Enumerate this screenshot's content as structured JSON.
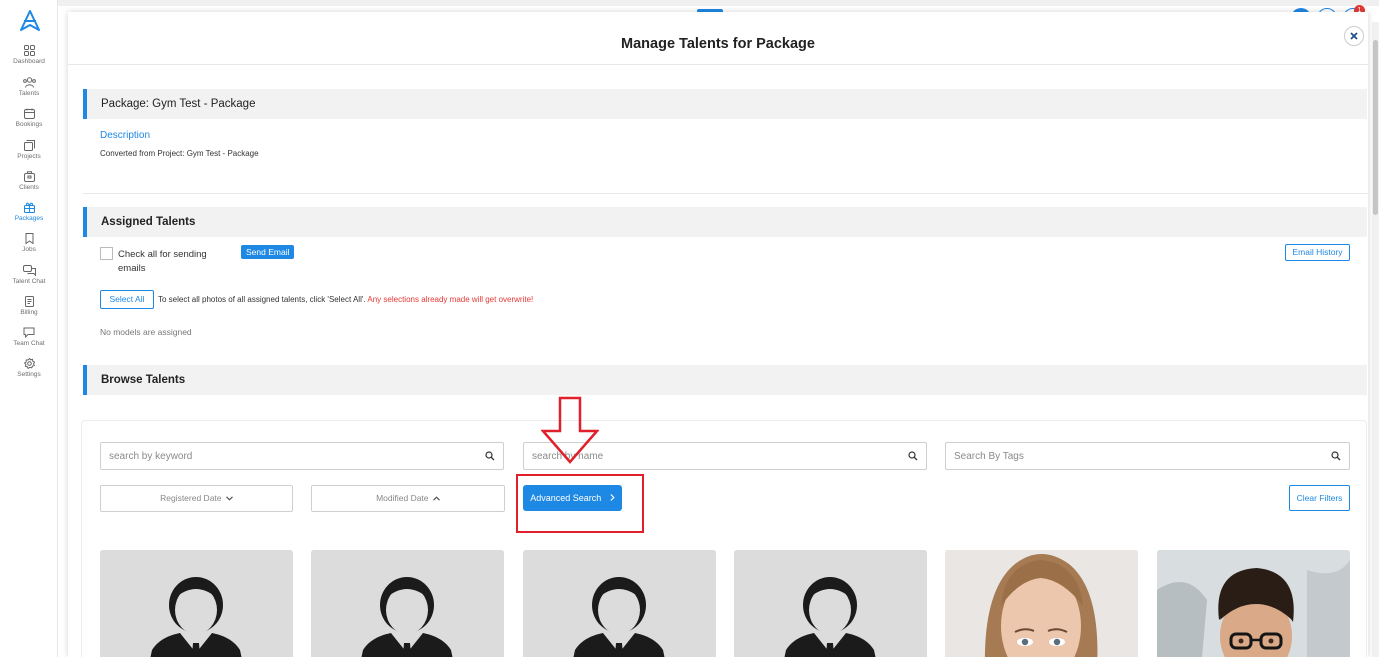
{
  "nav": {
    "items": [
      {
        "label": "Dashboard",
        "icon": "dashboard-icon"
      },
      {
        "label": "Talents",
        "icon": "talents-icon"
      },
      {
        "label": "Bookings",
        "icon": "bookings-icon"
      },
      {
        "label": "Projects",
        "icon": "projects-icon"
      },
      {
        "label": "Clients",
        "icon": "clients-icon"
      },
      {
        "label": "Packages",
        "icon": "packages-icon"
      },
      {
        "label": "Jobs",
        "icon": "jobs-icon"
      },
      {
        "label": "Talent Chat",
        "icon": "talent-chat-icon"
      },
      {
        "label": "Billing",
        "icon": "billing-icon"
      },
      {
        "label": "Team Chat",
        "icon": "team-chat-icon"
      },
      {
        "label": "Settings",
        "icon": "settings-icon"
      }
    ],
    "active": "Packages"
  },
  "topbar": {
    "notification_count": "1"
  },
  "modal": {
    "title": "Manage Talents for Package",
    "package_heading": "Package: Gym Test - Package",
    "description_label": "Description",
    "description_text": "Converted from Project: Gym Test - Package",
    "assigned_heading": "Assigned Talents",
    "check_all_label": "Check all for sending emails",
    "send_email_label": "Send Email",
    "email_history_label": "Email History",
    "select_all_label": "Select All",
    "select_help_text": "To select all photos of all assigned talents, click 'Select All'.",
    "select_warning_text": "Any selections already made will get overwrite!",
    "no_models_text": "No models are assigned",
    "browse_heading": "Browse Talents"
  },
  "filters": {
    "keyword_placeholder": "search by keyword",
    "name_placeholder": "search by name",
    "tags_placeholder": "Search By Tags",
    "registered_date_label": "Registered Date",
    "modified_date_label": "Modified Date",
    "advanced_search_label": "Advanced Search",
    "clear_filters_label": "Clear Filters"
  },
  "talents": [
    {
      "photo": "placeholder-avatar"
    },
    {
      "photo": "placeholder-avatar"
    },
    {
      "photo": "placeholder-avatar"
    },
    {
      "photo": "placeholder-avatar"
    },
    {
      "photo": "woman-portrait"
    },
    {
      "photo": "man-glasses-portrait"
    }
  ],
  "colors": {
    "accent": "#1e88e5",
    "warning": "#e53935",
    "highlight": "#e0202a"
  }
}
